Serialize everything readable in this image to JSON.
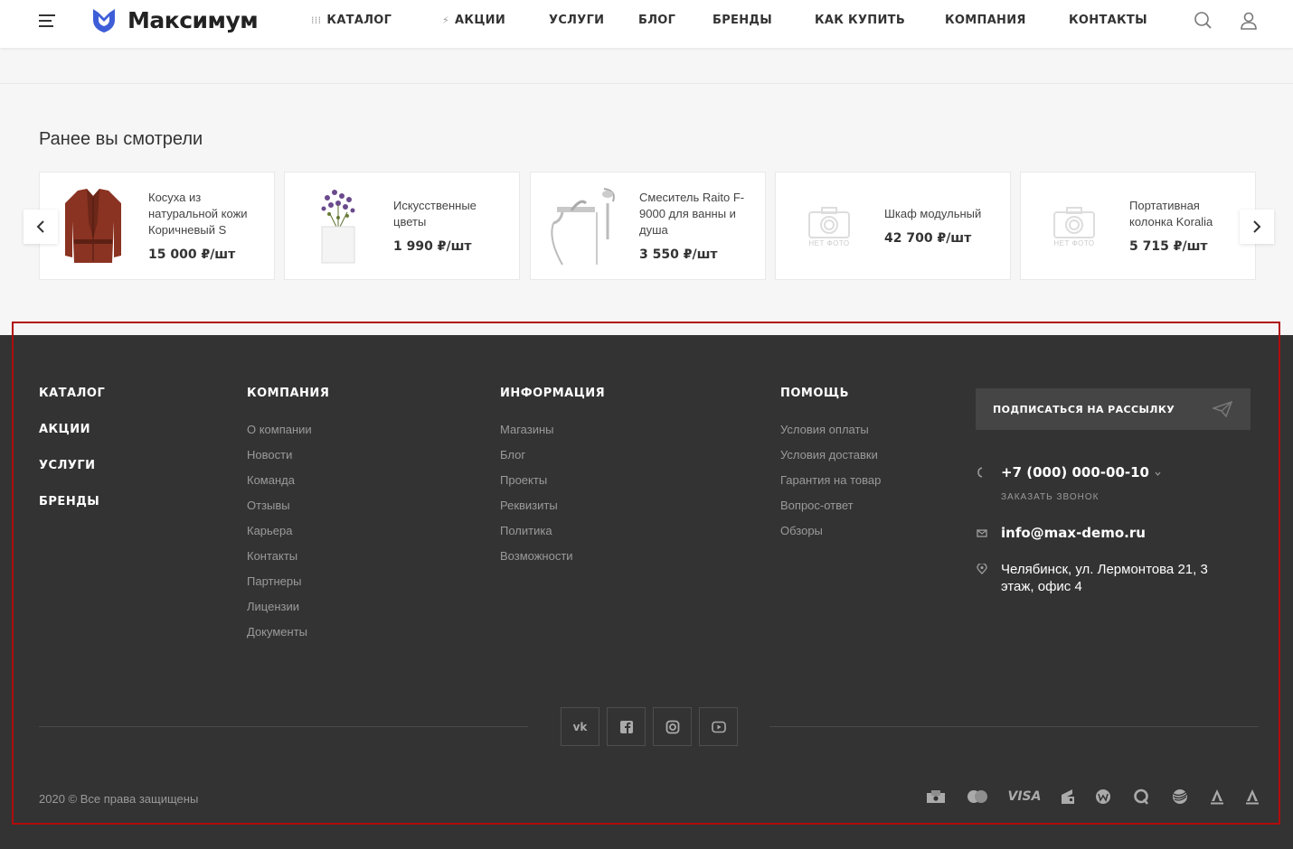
{
  "header": {
    "brand": "Максимум",
    "nav": [
      {
        "label": "КАТАЛОГ",
        "icon": "grid-icon"
      },
      {
        "label": "АКЦИИ",
        "icon": "lightning-icon"
      },
      {
        "label": "УСЛУГИ"
      },
      {
        "label": "БЛОГ"
      },
      {
        "label": "БРЕНДЫ"
      },
      {
        "label": "КАК КУПИТЬ"
      },
      {
        "label": "КОМПАНИЯ"
      },
      {
        "label": "КОНТАКТЫ"
      }
    ],
    "accent": "#3e5ed8"
  },
  "recent": {
    "title": "Ранее вы смотрели",
    "no_photo": "НЕТ ФОТО",
    "items": [
      {
        "name": "Косуха из натуральной кожи Коричневый S",
        "price": "15 000 ₽/шт"
      },
      {
        "name": "Искусственные цветы",
        "price": "1 990 ₽/шт"
      },
      {
        "name": "Смеситель Raito F-9000 для ванны и душа",
        "price": "3 550 ₽/шт"
      },
      {
        "name": "Шкаф модульный",
        "price": "42 700 ₽/шт"
      },
      {
        "name": "Портативная колонка Koralia",
        "price": "5 715 ₽/шт"
      }
    ]
  },
  "footer": {
    "col1": [
      "КАТАЛОГ",
      "АКЦИИ",
      "УСЛУГИ",
      "БРЕНДЫ"
    ],
    "company": {
      "title": "КОМПАНИЯ",
      "links": [
        "О компании",
        "Новости",
        "Команда",
        "Отзывы",
        "Карьера",
        "Контакты",
        "Партнеры",
        "Лицензии",
        "Документы"
      ]
    },
    "info": {
      "title": "ИНФОРМАЦИЯ",
      "links": [
        "Магазины",
        "Блог",
        "Проекты",
        "Реквизиты",
        "Политика",
        "Возможности"
      ]
    },
    "help": {
      "title": "ПОМОЩЬ",
      "links": [
        "Условия оплаты",
        "Условия доставки",
        "Гарантия на товар",
        "Вопрос-ответ",
        "Обзоры"
      ]
    },
    "subscribe": "ПОДПИСАТЬСЯ НА РАССЫЛКУ",
    "phone": "+7 (000) 000-00-10",
    "callback": "ЗАКАЗАТЬ ЗВОНОК",
    "email": "info@max-demo.ru",
    "address_line1": "Челябинск, ул. Лермонтова 21, 3",
    "address_line2": "этаж, офис 4",
    "copyright": "2020 © Все права защищены",
    "social": [
      "vk-icon",
      "facebook-icon",
      "instagram-icon",
      "youtube-icon"
    ],
    "payments": [
      "cash-icon",
      "mastercard-icon",
      "visa-icon",
      "yandex-money-icon",
      "webmoney-icon",
      "qiwi-icon",
      "sberbank-icon",
      "alfa-bank-icon",
      "alfa-click-icon"
    ]
  }
}
